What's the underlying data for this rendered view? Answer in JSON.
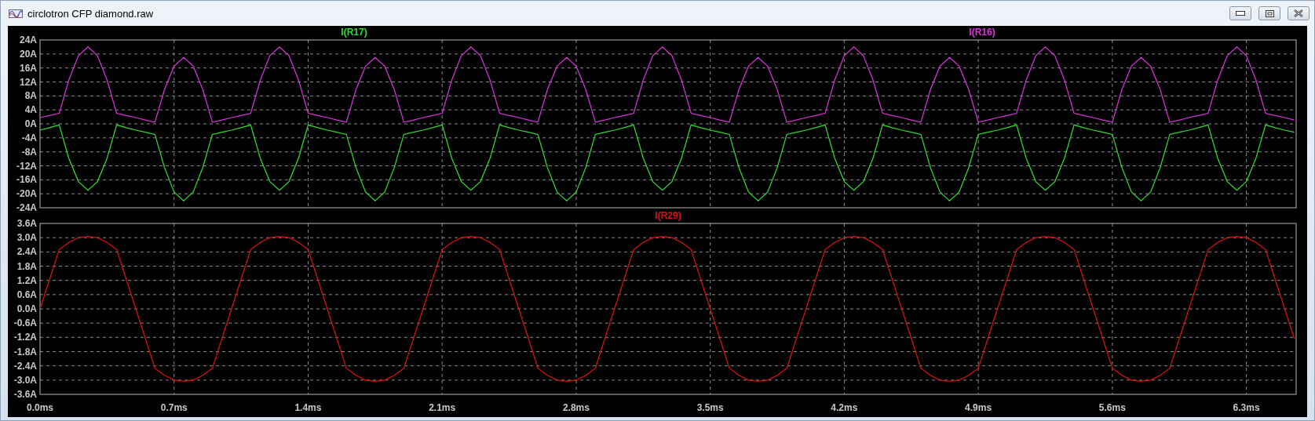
{
  "window": {
    "title": "circlotron CFP diamond.raw"
  },
  "panes": [
    {
      "chart_data": {
        "type": "line",
        "grid": true,
        "xlim": [
          0,
          6.56
        ],
        "ylim": [
          -24,
          24
        ],
        "yticks": [
          {
            "value": 24,
            "label": "24A"
          },
          {
            "value": 20,
            "label": "20A"
          },
          {
            "value": 16,
            "label": "16A"
          },
          {
            "value": 12,
            "label": "12A"
          },
          {
            "value": 8,
            "label": "8A"
          },
          {
            "value": 4,
            "label": "4A"
          },
          {
            "value": 0,
            "label": "0A"
          },
          {
            "value": -4,
            "label": "-4A"
          },
          {
            "value": -8,
            "label": "-8A"
          },
          {
            "value": -12,
            "label": "-12A"
          },
          {
            "value": -16,
            "label": "-16A"
          },
          {
            "value": -20,
            "label": "-20A"
          },
          {
            "value": -24,
            "label": "-24A"
          }
        ],
        "x": [
          0,
          0.05,
          0.1,
          0.15,
          0.2,
          0.25,
          0.3,
          0.35,
          0.4,
          0.45,
          0.5,
          0.55,
          0.6,
          0.65,
          0.7,
          0.75,
          0.8,
          0.85,
          0.9,
          0.95,
          1,
          1.05,
          1.1,
          1.15,
          1.2,
          1.25,
          1.3,
          1.35,
          1.4,
          1.45,
          1.5,
          1.55,
          1.6,
          1.65,
          1.7,
          1.75,
          1.8,
          1.85,
          1.9,
          1.95,
          2,
          2.05,
          2.1,
          2.15,
          2.2,
          2.25,
          2.3,
          2.35,
          2.4,
          2.45,
          2.5,
          2.55,
          2.6,
          2.65,
          2.7,
          2.75,
          2.8,
          2.85,
          2.9,
          2.95,
          3,
          3.05,
          3.1,
          3.15,
          3.2,
          3.25,
          3.3,
          3.35,
          3.4,
          3.45,
          3.5,
          3.55,
          3.6,
          3.65,
          3.7,
          3.75,
          3.8,
          3.85,
          3.9,
          3.95,
          4,
          4.05,
          4.1,
          4.15,
          4.2,
          4.25,
          4.3,
          4.35,
          4.4,
          4.45,
          4.5,
          4.55,
          4.6,
          4.65,
          4.7,
          4.75,
          4.8,
          4.85,
          4.9,
          4.95,
          5,
          5.05,
          5.1,
          5.15,
          5.2,
          5.25,
          5.3,
          5.35,
          5.4,
          5.45,
          5.5,
          5.55,
          5.6,
          5.65,
          5.7,
          5.75,
          5.8,
          5.85,
          5.9,
          5.95,
          6,
          6.05,
          6.1,
          6.15,
          6.2,
          6.25,
          6.3,
          6.35,
          6.4,
          6.45,
          6.5,
          6.55
        ],
        "series": [
          {
            "name": "I(R17)",
            "color": "#33dd33",
            "values": [
              -1.8,
              -1.1,
              -0.3,
              -9.8,
              -16.5,
              -19,
              -16.5,
              -9.8,
              -0.3,
              -1.1,
              -1.8,
              -2.4,
              -3,
              -12.5,
              -19.5,
              -22,
              -19.5,
              -12.5,
              -3,
              -2.4,
              -1.8,
              -1.1,
              -0.3,
              -9.8,
              -16.5,
              -19,
              -16.5,
              -9.8,
              -0.3,
              -1.1,
              -1.8,
              -2.4,
              -3,
              -12.5,
              -19.5,
              -22,
              -19.5,
              -12.5,
              -3,
              -2.4,
              -1.8,
              -1.1,
              -0.3,
              -9.8,
              -16.5,
              -19,
              -16.5,
              -9.8,
              -0.3,
              -1.1,
              -1.8,
              -2.4,
              -3,
              -12.5,
              -19.5,
              -22,
              -19.5,
              -12.5,
              -3,
              -2.4,
              -1.8,
              -1.1,
              -0.3,
              -9.8,
              -16.5,
              -19,
              -16.5,
              -9.8,
              -0.3,
              -1.1,
              -1.8,
              -2.4,
              -3,
              -12.5,
              -19.5,
              -22,
              -19.5,
              -12.5,
              -3,
              -2.4,
              -1.8,
              -1.1,
              -0.3,
              -9.8,
              -16.5,
              -19,
              -16.5,
              -9.8,
              -0.3,
              -1.1,
              -1.8,
              -2.4,
              -3,
              -12.5,
              -19.5,
              -22,
              -19.5,
              -12.5,
              -3,
              -2.4,
              -1.8,
              -1.1,
              -0.3,
              -9.8,
              -16.5,
              -19,
              -16.5,
              -9.8,
              -0.3,
              -1.1,
              -1.8,
              -2.4,
              -3,
              -12.5,
              -19.5,
              -22,
              -19.5,
              -12.5,
              -3,
              -2.4,
              -1.8,
              -1.1,
              -0.3,
              -9.8,
              -16.5,
              -19,
              -16.5,
              -9.8,
              -0.3,
              -1.1,
              -1.8,
              -2.4
            ]
          },
          {
            "name": "I(R16)",
            "color": "#dd33dd",
            "values": [
              1.8,
              2.4,
              3,
              12.5,
              19.5,
              22,
              19.5,
              12.5,
              3,
              2.4,
              1.8,
              1.1,
              0.5,
              9.8,
              16.5,
              19,
              16.5,
              9.8,
              0.5,
              1.1,
              1.8,
              2.4,
              3,
              12.5,
              19.5,
              22,
              19.5,
              12.5,
              3,
              2.4,
              1.8,
              1.1,
              0.5,
              9.8,
              16.5,
              19,
              16.5,
              9.8,
              0.5,
              1.1,
              1.8,
              2.4,
              3,
              12.5,
              19.5,
              22,
              19.5,
              12.5,
              3,
              2.4,
              1.8,
              1.1,
              0.5,
              9.8,
              16.5,
              19,
              16.5,
              9.8,
              0.5,
              1.1,
              1.8,
              2.4,
              3,
              12.5,
              19.5,
              22,
              19.5,
              12.5,
              3,
              2.4,
              1.8,
              1.1,
              0.5,
              9.8,
              16.5,
              19,
              16.5,
              9.8,
              0.5,
              1.1,
              1.8,
              2.4,
              3,
              12.5,
              19.5,
              22,
              19.5,
              12.5,
              3,
              2.4,
              1.8,
              1.1,
              0.5,
              9.8,
              16.5,
              19,
              16.5,
              9.8,
              0.5,
              1.1,
              1.8,
              2.4,
              3,
              12.5,
              19.5,
              22,
              19.5,
              12.5,
              3,
              2.4,
              1.8,
              1.1,
              0.5,
              9.8,
              16.5,
              19,
              16.5,
              9.8,
              0.5,
              1.1,
              1.8,
              2.4,
              3,
              12.5,
              19.5,
              22,
              19.5,
              12.5,
              3,
              2.4,
              1.8,
              1.1
            ]
          }
        ]
      }
    },
    {
      "chart_data": {
        "type": "line",
        "grid": true,
        "xlim": [
          0,
          6.56
        ],
        "ylim": [
          -3.6,
          3.6
        ],
        "xticks": [
          {
            "value": 0,
            "label": "0.0ms"
          },
          {
            "value": 0.7,
            "label": "0.7ms"
          },
          {
            "value": 1.4,
            "label": "1.4ms"
          },
          {
            "value": 2.1,
            "label": "2.1ms"
          },
          {
            "value": 2.8,
            "label": "2.8ms"
          },
          {
            "value": 3.5,
            "label": "3.5ms"
          },
          {
            "value": 4.2,
            "label": "4.2ms"
          },
          {
            "value": 4.9,
            "label": "4.9ms"
          },
          {
            "value": 5.6,
            "label": "5.6ms"
          },
          {
            "value": 6.3,
            "label": "6.3ms"
          }
        ],
        "yticks": [
          {
            "value": 3.6,
            "label": "3.6A"
          },
          {
            "value": 3,
            "label": "3.0A"
          },
          {
            "value": 2.4,
            "label": "2.4A"
          },
          {
            "value": 1.8,
            "label": "1.8A"
          },
          {
            "value": 1.2,
            "label": "1.2A"
          },
          {
            "value": 0.6,
            "label": "0.6A"
          },
          {
            "value": 0,
            "label": "0.0A"
          },
          {
            "value": -0.6,
            "label": "-0.6A"
          },
          {
            "value": -1.2,
            "label": "-1.2A"
          },
          {
            "value": -1.8,
            "label": "-1.8A"
          },
          {
            "value": -2.4,
            "label": "-2.4A"
          },
          {
            "value": -3,
            "label": "-3.0A"
          },
          {
            "value": -3.6,
            "label": "-3.6A"
          }
        ],
        "x": [
          0,
          0.05,
          0.1,
          0.15,
          0.2,
          0.25,
          0.3,
          0.35,
          0.4,
          0.45,
          0.5,
          0.55,
          0.6,
          0.65,
          0.7,
          0.75,
          0.8,
          0.85,
          0.9,
          0.95,
          1,
          1.05,
          1.1,
          1.15,
          1.2,
          1.25,
          1.3,
          1.35,
          1.4,
          1.45,
          1.5,
          1.55,
          1.6,
          1.65,
          1.7,
          1.75,
          1.8,
          1.85,
          1.9,
          1.95,
          2,
          2.05,
          2.1,
          2.15,
          2.2,
          2.25,
          2.3,
          2.35,
          2.4,
          2.45,
          2.5,
          2.55,
          2.6,
          2.65,
          2.7,
          2.75,
          2.8,
          2.85,
          2.9,
          2.95,
          3,
          3.05,
          3.1,
          3.15,
          3.2,
          3.25,
          3.3,
          3.35,
          3.4,
          3.45,
          3.5,
          3.55,
          3.6,
          3.65,
          3.7,
          3.75,
          3.8,
          3.85,
          3.9,
          3.95,
          4,
          4.05,
          4.1,
          4.15,
          4.2,
          4.25,
          4.3,
          4.35,
          4.4,
          4.45,
          4.5,
          4.55,
          4.6,
          4.65,
          4.7,
          4.75,
          4.8,
          4.85,
          4.9,
          4.95,
          5,
          5.05,
          5.1,
          5.15,
          5.2,
          5.25,
          5.3,
          5.35,
          5.4,
          5.45,
          5.5,
          5.55,
          5.6,
          5.65,
          5.7,
          5.75,
          5.8,
          5.85,
          5.9,
          5.95,
          6,
          6.05,
          6.1,
          6.15,
          6.2,
          6.25,
          6.3,
          6.35,
          6.4,
          6.45,
          6.5,
          6.55
        ],
        "series": [
          {
            "name": "I(R29)",
            "color": "#dd1111",
            "values": [
              0,
              1.25,
              2.5,
              2.8,
              3,
              3.05,
              3,
              2.8,
              2.5,
              1.25,
              0,
              -1.25,
              -2.5,
              -2.8,
              -3,
              -3.05,
              -3,
              -2.8,
              -2.5,
              -1.25,
              0,
              1.25,
              2.5,
              2.8,
              3,
              3.05,
              3,
              2.8,
              2.5,
              1.25,
              0,
              -1.25,
              -2.5,
              -2.8,
              -3,
              -3.05,
              -3,
              -2.8,
              -2.5,
              -1.25,
              0,
              1.25,
              2.5,
              2.8,
              3,
              3.05,
              3,
              2.8,
              2.5,
              1.25,
              0,
              -1.25,
              -2.5,
              -2.8,
              -3,
              -3.05,
              -3,
              -2.8,
              -2.5,
              -1.25,
              0,
              1.25,
              2.5,
              2.8,
              3,
              3.05,
              3,
              2.8,
              2.5,
              1.25,
              0,
              -1.25,
              -2.5,
              -2.8,
              -3,
              -3.05,
              -3,
              -2.8,
              -2.5,
              -1.25,
              0,
              1.25,
              2.5,
              2.8,
              3,
              3.05,
              3,
              2.8,
              2.5,
              1.25,
              0,
              -1.25,
              -2.5,
              -2.8,
              -3,
              -3.05,
              -3,
              -2.8,
              -2.5,
              -1.25,
              0,
              1.25,
              2.5,
              2.8,
              3,
              3.05,
              3,
              2.8,
              2.5,
              1.25,
              0,
              -1.25,
              -2.5,
              -2.8,
              -3,
              -3.05,
              -3,
              -2.8,
              -2.5,
              -1.25,
              0,
              1.25,
              2.5,
              2.8,
              3,
              3.05,
              3,
              2.8,
              2.5,
              1.25,
              0,
              -1.25
            ]
          }
        ]
      }
    }
  ]
}
